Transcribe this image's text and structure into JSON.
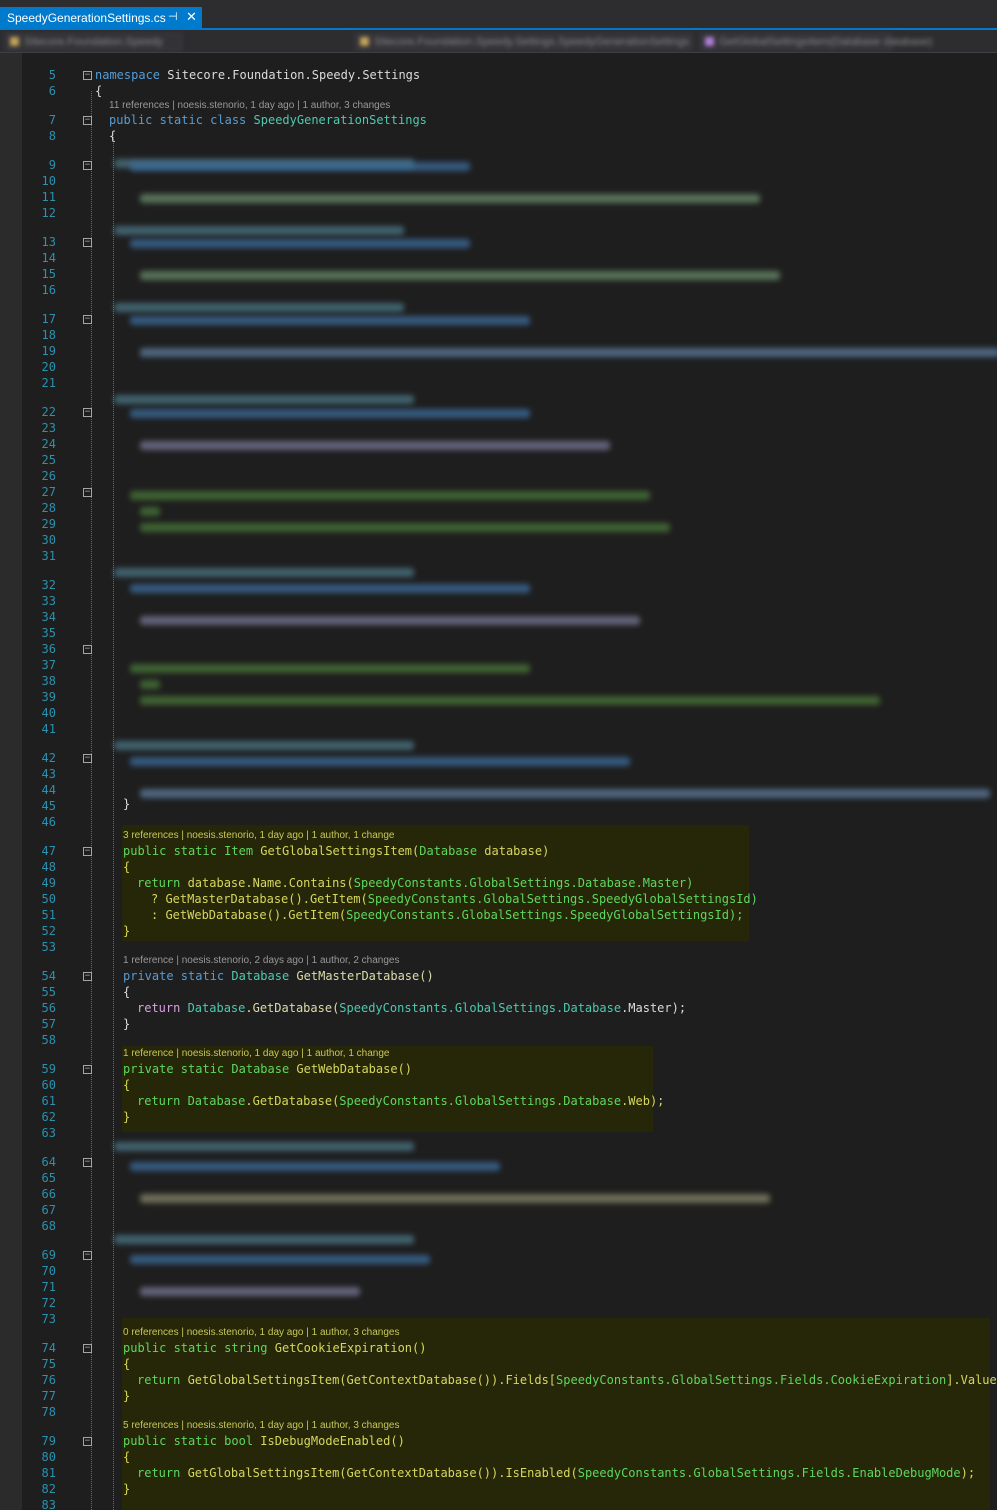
{
  "tab": {
    "title": "SpeedyGenerationSettings.cs",
    "pin_glyph": "⊣",
    "close_glyph": "✕"
  },
  "nav": {
    "project": "Sitecore.Foundation.Speedy",
    "class_path": "Sitecore.Foundation.Speedy.Settings.SpeedyGenerationSettings",
    "member": "GetGlobalSettingsItem(Database database)"
  },
  "line_numbers": [
    "5",
    "6",
    "7",
    "8",
    "9",
    "10",
    "11",
    "12",
    "13",
    "14",
    "15",
    "16",
    "17",
    "18",
    "19",
    "20",
    "21",
    "22",
    "23",
    "24",
    "25",
    "26",
    "27",
    "28",
    "29",
    "30",
    "31",
    "32",
    "33",
    "34",
    "35",
    "36",
    "37",
    "38",
    "39",
    "40",
    "41",
    "42",
    "43",
    "44",
    "45",
    "46",
    "47",
    "48",
    "49",
    "50",
    "51",
    "52",
    "53",
    "54",
    "55",
    "56",
    "57",
    "58",
    "59",
    "60",
    "61",
    "62",
    "63",
    "64",
    "65",
    "66",
    "67",
    "68",
    "69",
    "70",
    "71",
    "72",
    "73",
    "74",
    "75",
    "76",
    "77",
    "78",
    "79",
    "80",
    "81",
    "82",
    "83"
  ],
  "code": {
    "namespace_kw": "namespace",
    "namespace_name": "Sitecore.Foundation.Speedy.Settings",
    "open_brace": "{",
    "close_brace": "}",
    "class_lens": "11 references | noesis.stenorio, 1 day ago | 1 author, 3 changes",
    "class_kw": "public static class",
    "class_name": "SpeedyGenerationSettings",
    "m1_lens": "3 references | noesis.stenorio, 1 day ago | 1 author, 1 change",
    "m1_mods": "public static",
    "m1_type": "Item",
    "m1_name": "GetGlobalSettingsItem(",
    "m1_ptype": "Database",
    "m1_pname": " database)",
    "m1_l1a": "return ",
    "m1_l1b": "database.Name.Contains(",
    "m1_l1c": "SpeedyConstants.GlobalSettings.Database.Master)",
    "m1_l2a": "? ",
    "m1_l2b": "GetMasterDatabase().GetItem(",
    "m1_l2c": "SpeedyConstants.GlobalSettings.SpeedyGlobalSettingsId)",
    "m1_l3a": ": ",
    "m1_l3b": "GetWebDatabase().GetItem(",
    "m1_l3c": "SpeedyConstants.GlobalSettings.SpeedyGlobalSettingsId);",
    "m2_lens": "1 reference | noesis.stenorio, 2 days ago | 1 author, 2 changes",
    "m2_mods": "private static",
    "m2_type": "Database",
    "m2_name": "GetMasterDatabase()",
    "m2_l1a": "return ",
    "m2_l1b": "Database",
    "m2_l1c": ".GetDatabase(",
    "m2_l1d": "SpeedyConstants.GlobalSettings.Database",
    "m2_l1e": ".Master);",
    "m3_lens": "1 reference | noesis.stenorio, 1 day ago | 1 author, 1 change",
    "m3_mods": "private static",
    "m3_type": "Database",
    "m3_name": "GetWebDatabase()",
    "m3_l1a": "return ",
    "m3_l1b": "Database",
    "m3_l1c": ".GetDatabase(",
    "m3_l1d": "SpeedyConstants.GlobalSettings.Database",
    "m3_l1e": ".Web);",
    "m4_lens": "0 references | noesis.stenorio, 1 day ago | 1 author, 3 changes",
    "m4_mods": "public static",
    "m4_type": "string",
    "m4_name": "GetCookieExpiration()",
    "m4_l1a": "return ",
    "m4_l1b": "GetGlobalSettingsItem(GetContextDatabase()).Fields[",
    "m4_l1c": "SpeedyConstants.GlobalSettings.Fields.CookieExpiration",
    "m4_l1d": "].Value;",
    "m5_lens": "5 references | noesis.stenorio, 1 day ago | 1 author, 3 changes",
    "m5_mods": "public static",
    "m5_type": "bool",
    "m5_name": "IsDebugModeEnabled()",
    "m5_l1a": "return ",
    "m5_l1b": "GetGlobalSettingsItem(GetContextDatabase()).IsEnabled(",
    "m5_l1c": "SpeedyConstants.GlobalSettings.Fields.EnableDebugMode",
    "m5_l1d": ");"
  },
  "fold_glyph": "−"
}
